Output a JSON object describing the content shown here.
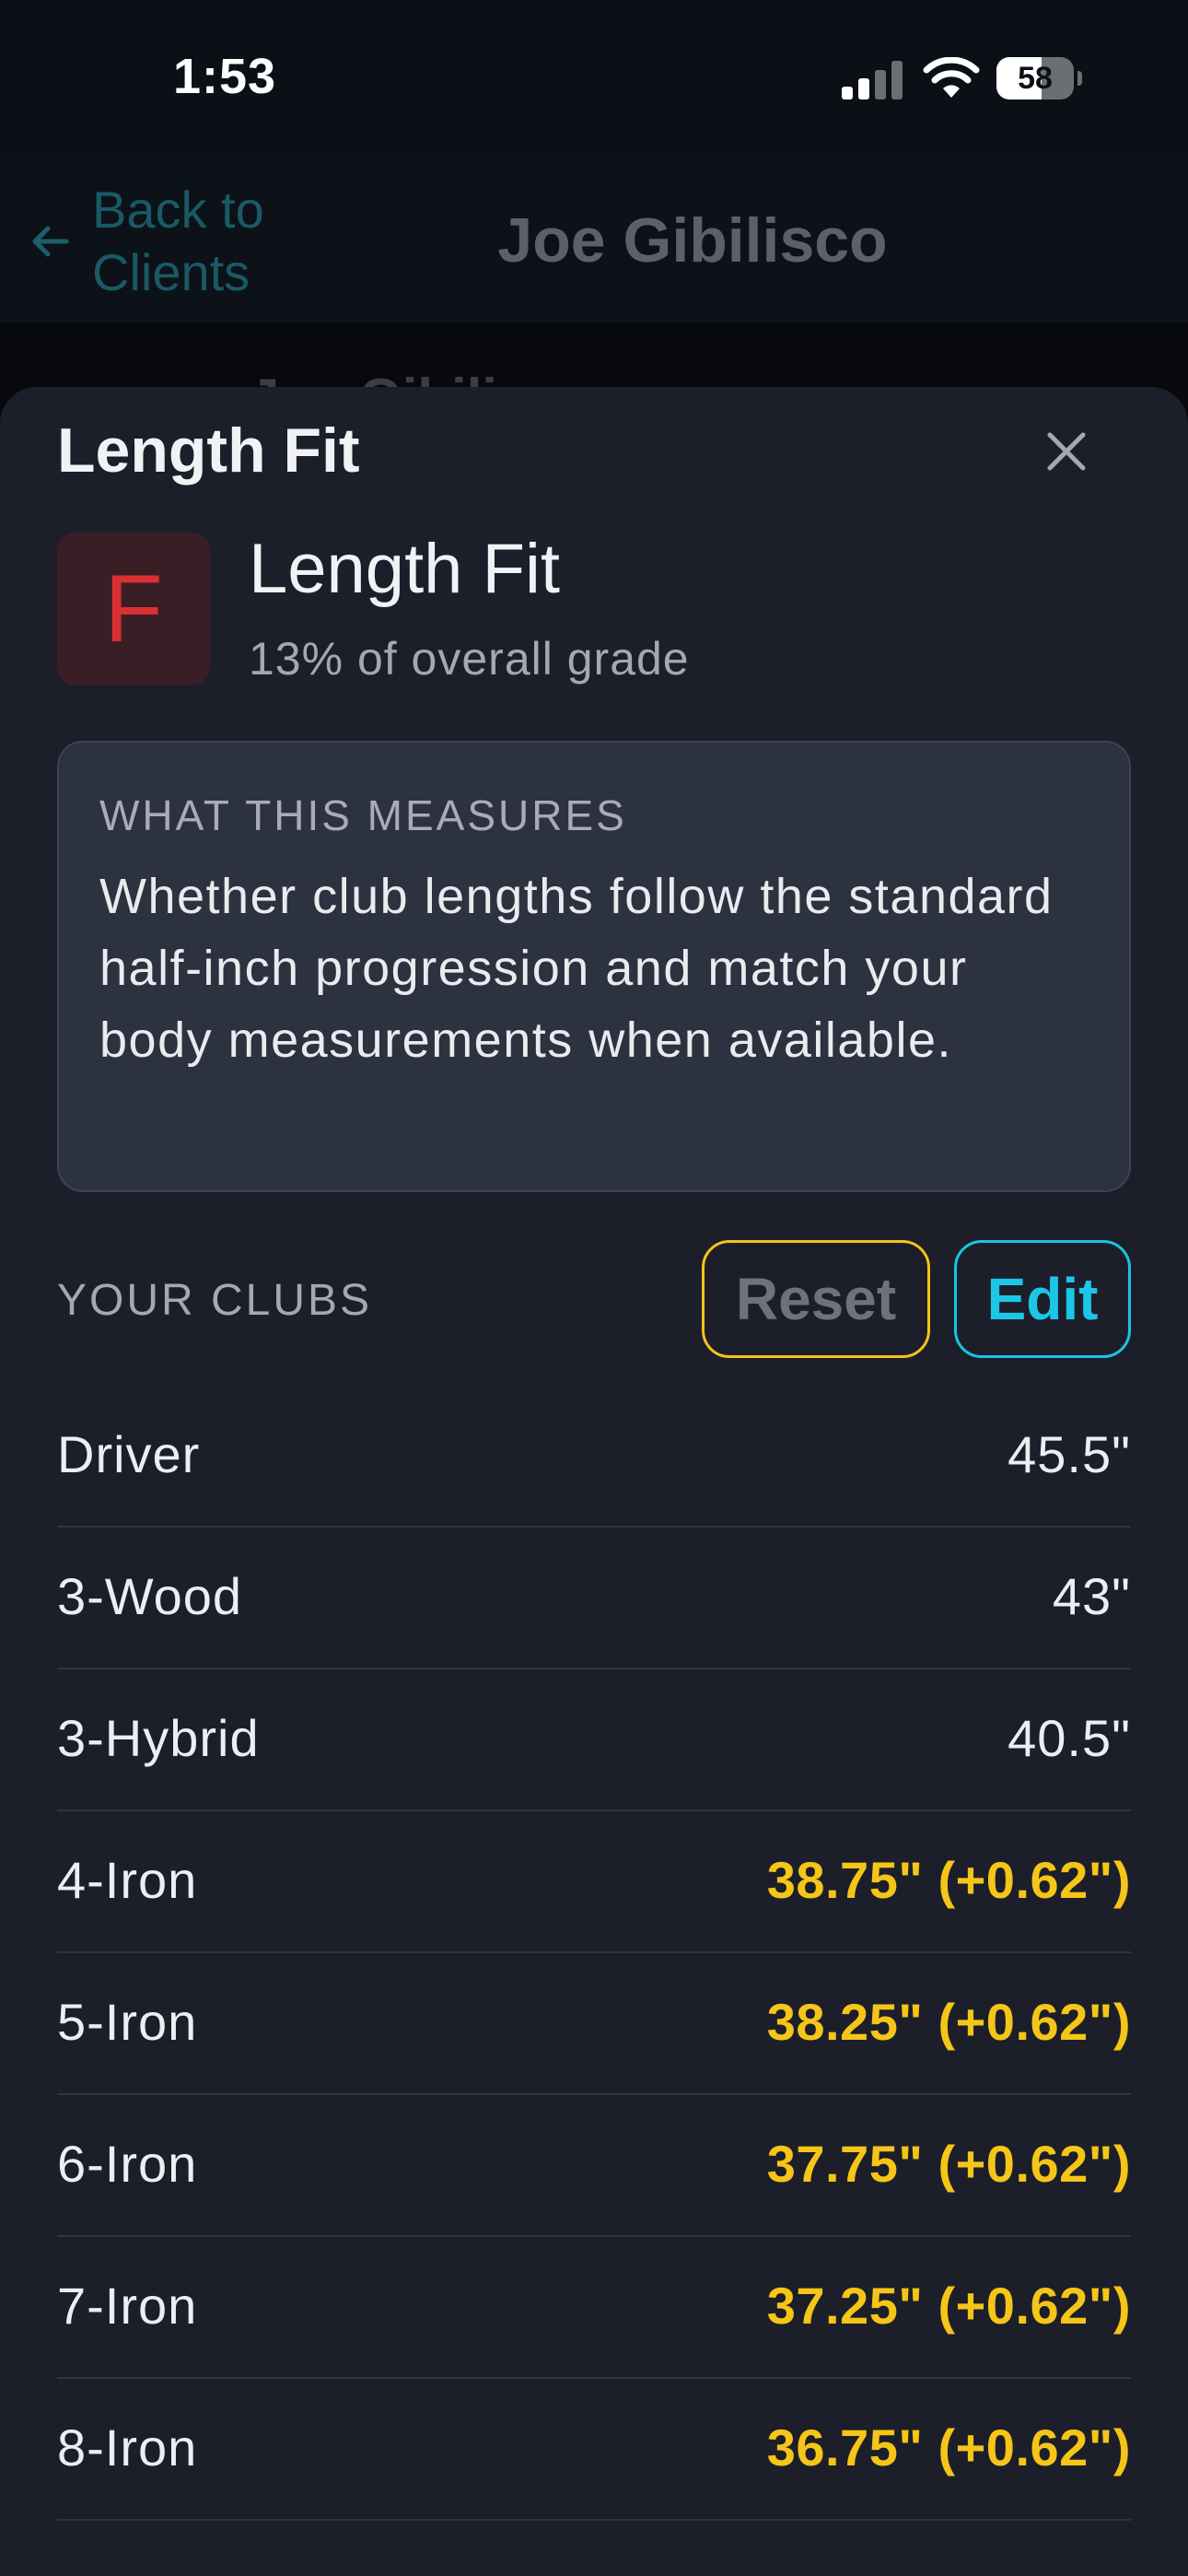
{
  "status_bar": {
    "time": "1:53",
    "battery_percent": "58",
    "battery_level": 0.58
  },
  "nav": {
    "back_label": "Back to Clients",
    "title": "Joe Gibilisco",
    "behind_text": "Joe Gibili"
  },
  "sheet": {
    "title": "Length Fit",
    "metric": {
      "grade": "F",
      "name": "Length Fit",
      "weight": "13% of overall grade"
    },
    "measures": {
      "heading": "WHAT THIS MEASURES",
      "body": "Whether club lengths follow the standard half-inch progression and match your body measurements when available."
    },
    "clubs_section": {
      "heading": "YOUR CLUBS",
      "reset_label": "Reset",
      "edit_label": "Edit"
    },
    "clubs": [
      {
        "name": "Driver",
        "length": "45.5\"",
        "flagged": false
      },
      {
        "name": "3-Wood",
        "length": "43\"",
        "flagged": false
      },
      {
        "name": "3-Hybrid",
        "length": "40.5\"",
        "flagged": false
      },
      {
        "name": "4-Iron",
        "length": "38.75\" (+0.62\")",
        "flagged": true
      },
      {
        "name": "5-Iron",
        "length": "38.25\" (+0.62\")",
        "flagged": true
      },
      {
        "name": "6-Iron",
        "length": "37.75\" (+0.62\")",
        "flagged": true
      },
      {
        "name": "7-Iron",
        "length": "37.25\" (+0.62\")",
        "flagged": true
      },
      {
        "name": "8-Iron",
        "length": "36.75\" (+0.62\")",
        "flagged": true
      }
    ]
  },
  "colors": {
    "accent_cyan": "#19c4e4",
    "warning_yellow": "#f5c518",
    "grade_red": "#dc2f33",
    "sheet_bg": "#1c1f29"
  },
  "icons": {
    "back": "arrow-left-icon",
    "close": "close-icon",
    "signal": "cellular-signal-icon",
    "wifi": "wifi-icon",
    "battery": "battery-icon"
  }
}
